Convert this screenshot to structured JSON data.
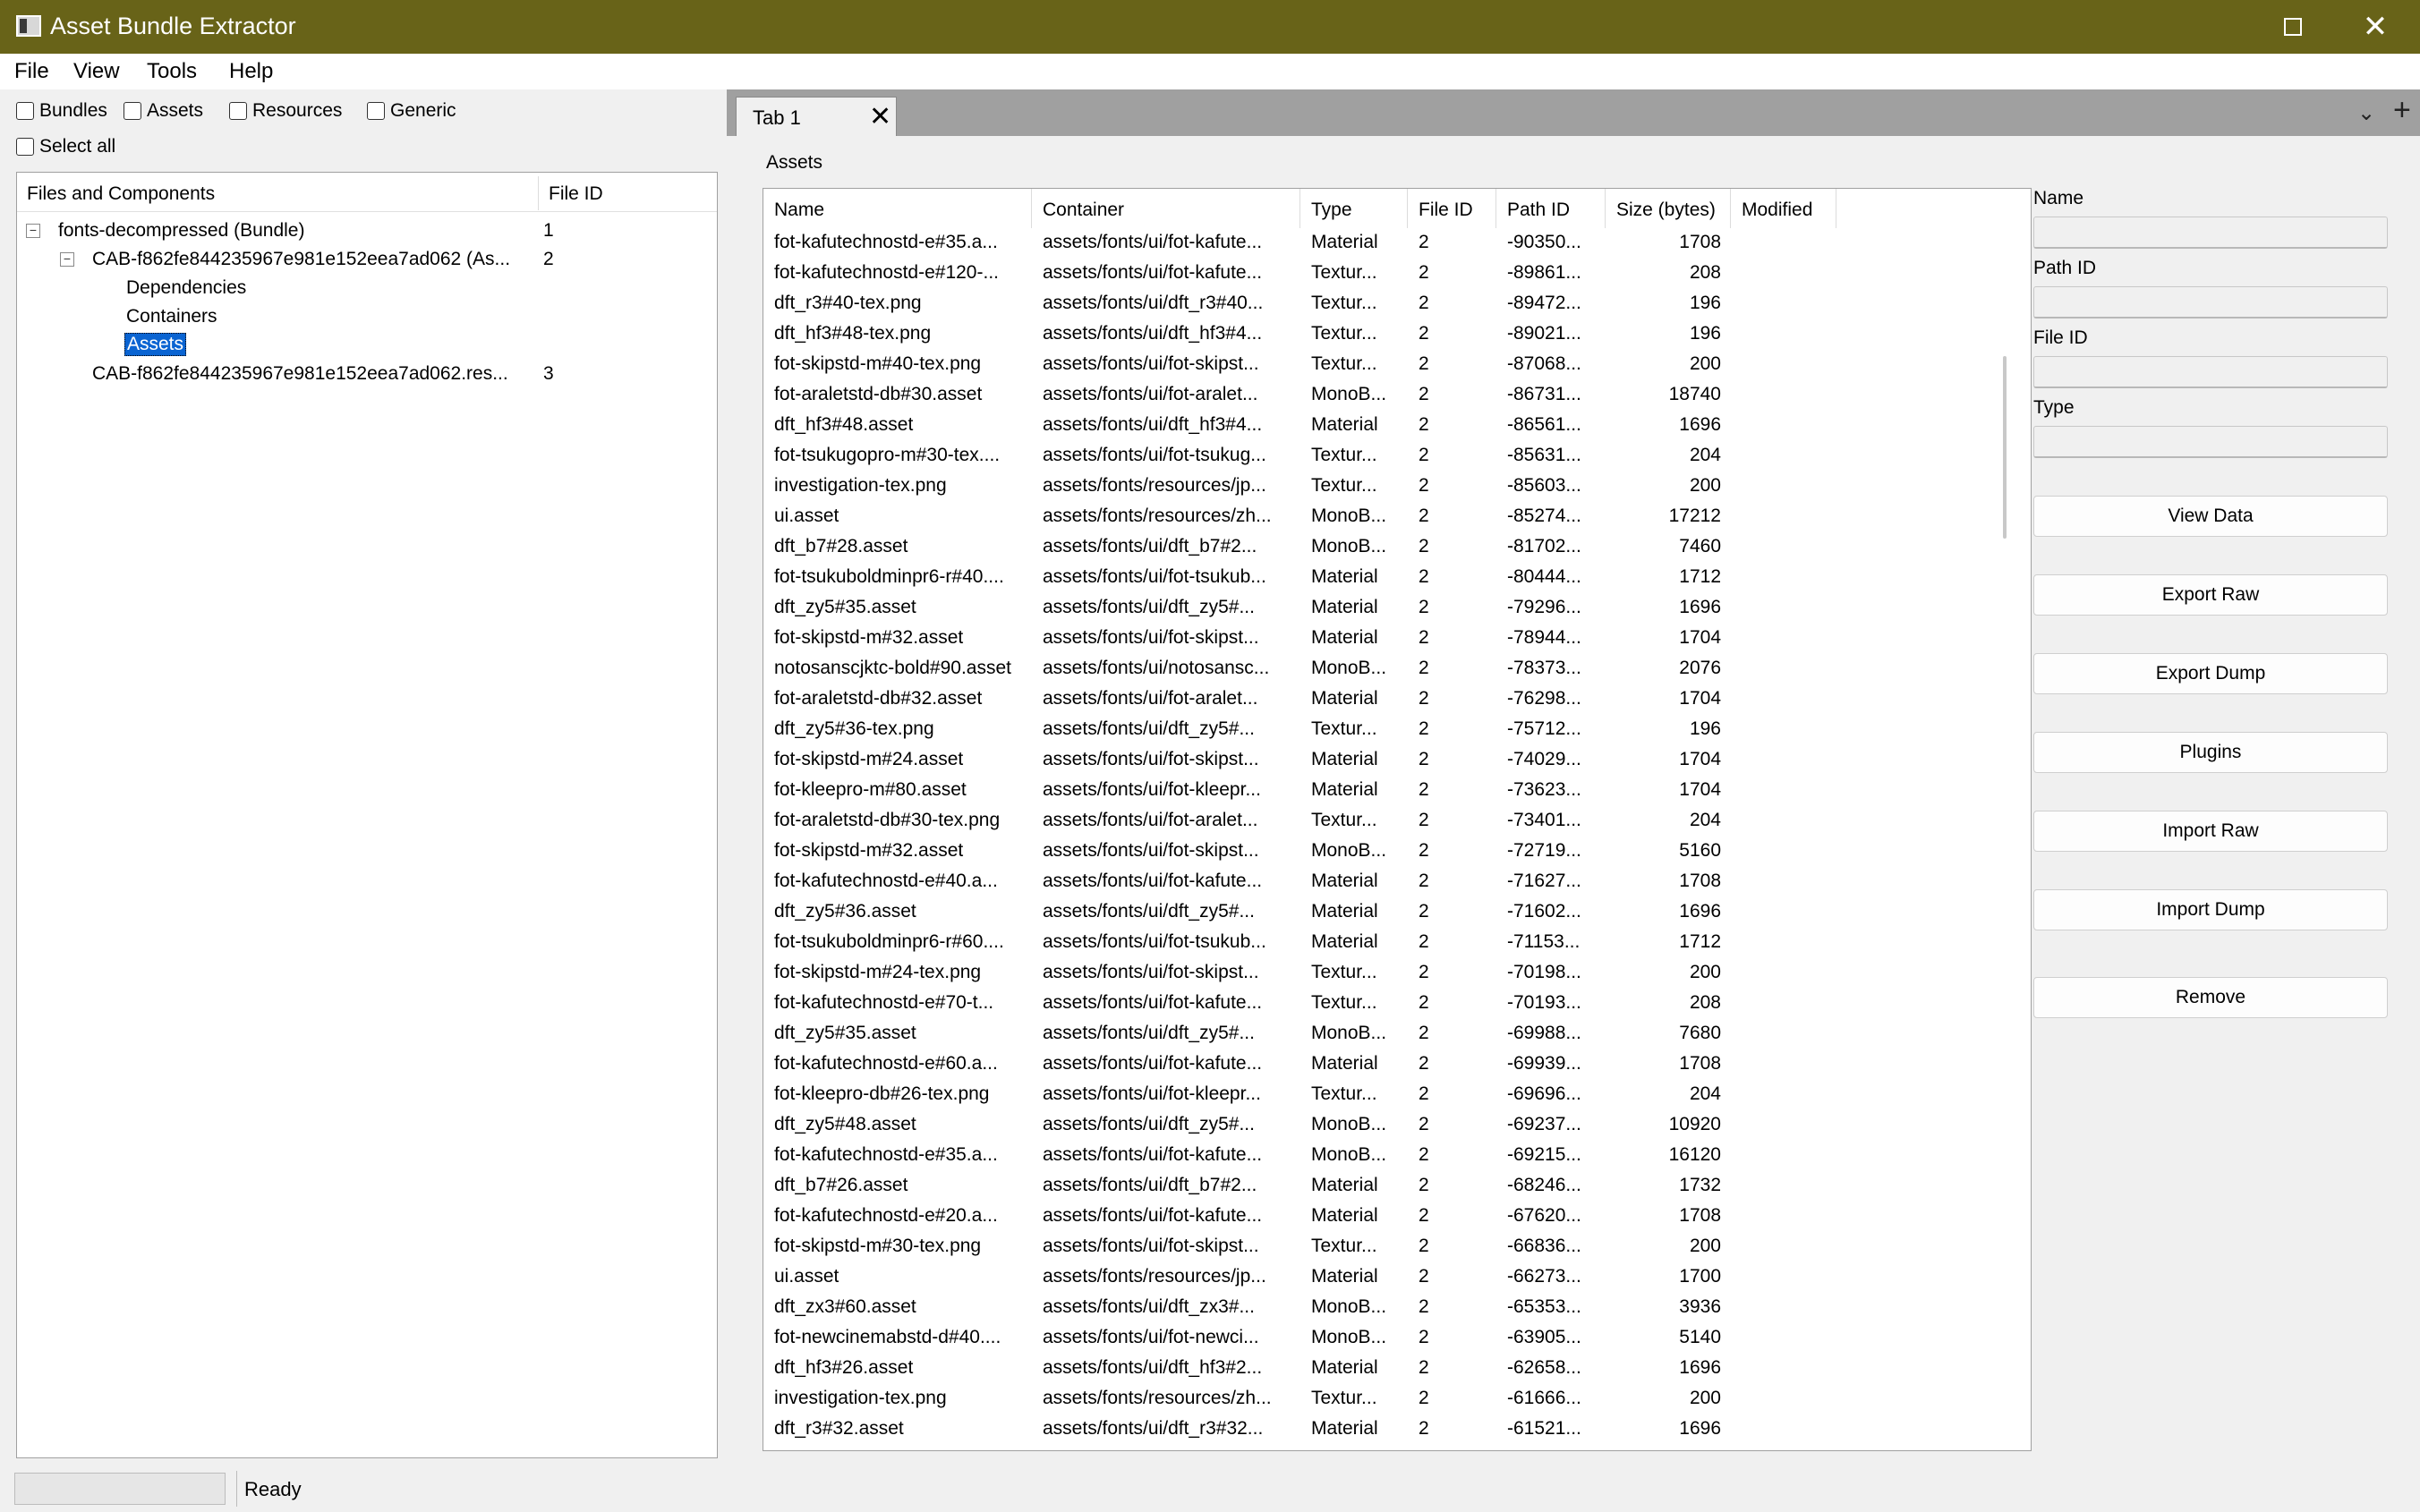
{
  "window": {
    "title": "Asset Bundle Extractor"
  },
  "menu": [
    "File",
    "View",
    "Tools",
    "Help"
  ],
  "filters": {
    "bundles": "Bundles",
    "assets": "Assets",
    "resources": "Resources",
    "generic": "Generic",
    "select_all": "Select all"
  },
  "tree": {
    "headers": {
      "name": "Files and Components",
      "file_id": "File ID"
    },
    "rows": [
      {
        "label": "fonts-decompressed (Bundle)",
        "file_id": "1",
        "expander": "−"
      },
      {
        "label": "CAB-f862fe844235967e981e152eea7ad062 (As...",
        "file_id": "2",
        "expander": "−"
      },
      {
        "label": "Dependencies",
        "file_id": ""
      },
      {
        "label": "Containers",
        "file_id": ""
      },
      {
        "label": "Assets",
        "file_id": "",
        "selected": true
      },
      {
        "label": "CAB-f862fe844235967e981e152eea7ad062.res...",
        "file_id": "3"
      }
    ]
  },
  "tabs": {
    "active": "Tab 1",
    "close_glyph": "✕",
    "more_glyph": "⌄",
    "add_glyph": "+"
  },
  "assets_panel": {
    "label": "Assets",
    "columns": [
      "Name",
      "Container",
      "Type",
      "File ID",
      "Path ID",
      "Size (bytes)",
      "Modified"
    ],
    "rows": [
      [
        "fot-kafutechnostd-e#35.a...",
        "assets/fonts/ui/fot-kafute...",
        "Material",
        "2",
        "-90350...",
        "1708"
      ],
      [
        "fot-kafutechnostd-e#120-...",
        "assets/fonts/ui/fot-kafute...",
        "Textur...",
        "2",
        "-89861...",
        "208"
      ],
      [
        "dft_r3#40-tex.png",
        "assets/fonts/ui/dft_r3#40...",
        "Textur...",
        "2",
        "-89472...",
        "196"
      ],
      [
        "dft_hf3#48-tex.png",
        "assets/fonts/ui/dft_hf3#4...",
        "Textur...",
        "2",
        "-89021...",
        "196"
      ],
      [
        "fot-skipstd-m#40-tex.png",
        "assets/fonts/ui/fot-skipst...",
        "Textur...",
        "2",
        "-87068...",
        "200"
      ],
      [
        "fot-araletstd-db#30.asset",
        "assets/fonts/ui/fot-aralet...",
        "MonoB...",
        "2",
        "-86731...",
        "18740"
      ],
      [
        "dft_hf3#48.asset",
        "assets/fonts/ui/dft_hf3#4...",
        "Material",
        "2",
        "-86561...",
        "1696"
      ],
      [
        "fot-tsukugopro-m#30-tex....",
        "assets/fonts/ui/fot-tsukug...",
        "Textur...",
        "2",
        "-85631...",
        "204"
      ],
      [
        "investigation-tex.png",
        "assets/fonts/resources/jp...",
        "Textur...",
        "2",
        "-85603...",
        "200"
      ],
      [
        "ui.asset",
        "assets/fonts/resources/zh...",
        "MonoB...",
        "2",
        "-85274...",
        "17212"
      ],
      [
        "dft_b7#28.asset",
        "assets/fonts/ui/dft_b7#2...",
        "MonoB...",
        "2",
        "-81702...",
        "7460"
      ],
      [
        "fot-tsukuboldminpr6-r#40....",
        "assets/fonts/ui/fot-tsukub...",
        "Material",
        "2",
        "-80444...",
        "1712"
      ],
      [
        "dft_zy5#35.asset",
        "assets/fonts/ui/dft_zy5#...",
        "Material",
        "2",
        "-79296...",
        "1696"
      ],
      [
        "fot-skipstd-m#32.asset",
        "assets/fonts/ui/fot-skipst...",
        "Material",
        "2",
        "-78944...",
        "1704"
      ],
      [
        "notosanscjktc-bold#90.asset",
        "assets/fonts/ui/notosansc...",
        "MonoB...",
        "2",
        "-78373...",
        "2076"
      ],
      [
        "fot-araletstd-db#32.asset",
        "assets/fonts/ui/fot-aralet...",
        "Material",
        "2",
        "-76298...",
        "1704"
      ],
      [
        "dft_zy5#36-tex.png",
        "assets/fonts/ui/dft_zy5#...",
        "Textur...",
        "2",
        "-75712...",
        "196"
      ],
      [
        "fot-skipstd-m#24.asset",
        "assets/fonts/ui/fot-skipst...",
        "Material",
        "2",
        "-74029...",
        "1704"
      ],
      [
        "fot-kleepro-m#80.asset",
        "assets/fonts/ui/fot-kleepr...",
        "Material",
        "2",
        "-73623...",
        "1704"
      ],
      [
        "fot-araletstd-db#30-tex.png",
        "assets/fonts/ui/fot-aralet...",
        "Textur...",
        "2",
        "-73401...",
        "204"
      ],
      [
        "fot-skipstd-m#32.asset",
        "assets/fonts/ui/fot-skipst...",
        "MonoB...",
        "2",
        "-72719...",
        "5160"
      ],
      [
        "fot-kafutechnostd-e#40.a...",
        "assets/fonts/ui/fot-kafute...",
        "Material",
        "2",
        "-71627...",
        "1708"
      ],
      [
        "dft_zy5#36.asset",
        "assets/fonts/ui/dft_zy5#...",
        "Material",
        "2",
        "-71602...",
        "1696"
      ],
      [
        "fot-tsukuboldminpr6-r#60....",
        "assets/fonts/ui/fot-tsukub...",
        "Material",
        "2",
        "-71153...",
        "1712"
      ],
      [
        "fot-skipstd-m#24-tex.png",
        "assets/fonts/ui/fot-skipst...",
        "Textur...",
        "2",
        "-70198...",
        "200"
      ],
      [
        "fot-kafutechnostd-e#70-t...",
        "assets/fonts/ui/fot-kafute...",
        "Textur...",
        "2",
        "-70193...",
        "208"
      ],
      [
        "dft_zy5#35.asset",
        "assets/fonts/ui/dft_zy5#...",
        "MonoB...",
        "2",
        "-69988...",
        "7680"
      ],
      [
        "fot-kafutechnostd-e#60.a...",
        "assets/fonts/ui/fot-kafute...",
        "Material",
        "2",
        "-69939...",
        "1708"
      ],
      [
        "fot-kleepro-db#26-tex.png",
        "assets/fonts/ui/fot-kleepr...",
        "Textur...",
        "2",
        "-69696...",
        "204"
      ],
      [
        "dft_zy5#48.asset",
        "assets/fonts/ui/dft_zy5#...",
        "MonoB...",
        "2",
        "-69237...",
        "10920"
      ],
      [
        "fot-kafutechnostd-e#35.a...",
        "assets/fonts/ui/fot-kafute...",
        "MonoB...",
        "2",
        "-69215...",
        "16120"
      ],
      [
        "dft_b7#26.asset",
        "assets/fonts/ui/dft_b7#2...",
        "Material",
        "2",
        "-68246...",
        "1732"
      ],
      [
        "fot-kafutechnostd-e#20.a...",
        "assets/fonts/ui/fot-kafute...",
        "Material",
        "2",
        "-67620...",
        "1708"
      ],
      [
        "fot-skipstd-m#30-tex.png",
        "assets/fonts/ui/fot-skipst...",
        "Textur...",
        "2",
        "-66836...",
        "200"
      ],
      [
        "ui.asset",
        "assets/fonts/resources/jp...",
        "Material",
        "2",
        "-66273...",
        "1700"
      ],
      [
        "dft_zx3#60.asset",
        "assets/fonts/ui/dft_zx3#...",
        "MonoB...",
        "2",
        "-65353...",
        "3936"
      ],
      [
        "fot-newcinemabstd-d#40....",
        "assets/fonts/ui/fot-newci...",
        "MonoB...",
        "2",
        "-63905...",
        "5140"
      ],
      [
        "dft_hf3#26.asset",
        "assets/fonts/ui/dft_hf3#2...",
        "Material",
        "2",
        "-62658...",
        "1696"
      ],
      [
        "investigation-tex.png",
        "assets/fonts/resources/zh...",
        "Textur...",
        "2",
        "-61666...",
        "200"
      ],
      [
        "dft_r3#32.asset",
        "assets/fonts/ui/dft_r3#32...",
        "Material",
        "2",
        "-61521...",
        "1696"
      ]
    ]
  },
  "info": {
    "fields": [
      {
        "label": "Name",
        "value": ""
      },
      {
        "label": "Path ID",
        "value": ""
      },
      {
        "label": "File ID",
        "value": ""
      },
      {
        "label": "Type",
        "value": ""
      }
    ],
    "buttons": [
      "View Data",
      "Export Raw",
      "Export Dump",
      "Plugins",
      "Import Raw",
      "Import Dump",
      "Remove"
    ]
  },
  "status": {
    "text": "Ready"
  },
  "colors": {
    "titlebar": "#686318",
    "selection": "#0a64d2"
  }
}
